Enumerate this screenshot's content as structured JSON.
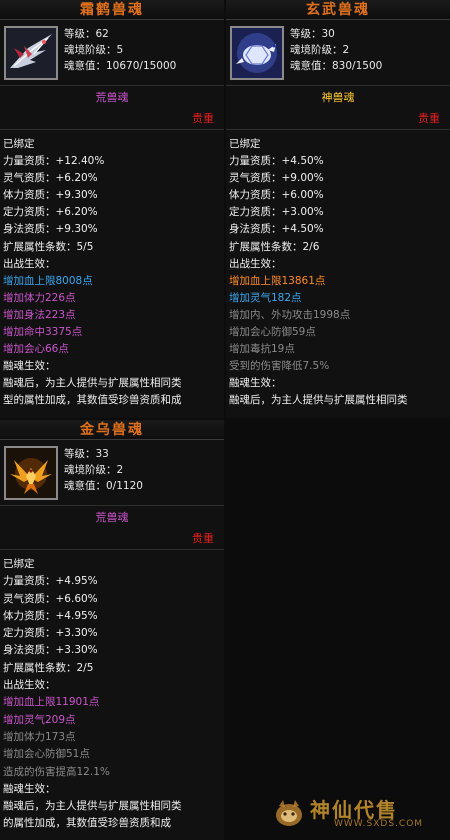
{
  "labels": {
    "level": "等级：",
    "realm": "魂境阶级：",
    "soul": "魂意值：",
    "valuable": "贵重",
    "bound": "已绑定",
    "ext_count": "扩展属性条数：",
    "battle": "出战生效：",
    "fusion": "融魂生效："
  },
  "cards": [
    {
      "title": "霜鹤兽魂",
      "icon": "frost-crane-icon",
      "level": "62",
      "realm": "5",
      "soul": "10670/15000",
      "grade": "荒兽魂",
      "aptitudes": [
        {
          "name": "力量资质：",
          "value": "+12.40%"
        },
        {
          "name": "灵气资质：",
          "value": "+6.20%"
        },
        {
          "name": "体力资质：",
          "value": "+9.30%"
        },
        {
          "name": "定力资质：",
          "value": "+6.20%"
        },
        {
          "name": "身法资质：",
          "value": "+9.30%"
        }
      ],
      "ext_count": "5/5",
      "effects": [
        {
          "text": "增加血上限8008点",
          "color": "blue"
        },
        {
          "text": "增加体力226点",
          "color": "purple"
        },
        {
          "text": "增加身法223点",
          "color": "purple"
        },
        {
          "text": "增加命中3375点",
          "color": "purple"
        },
        {
          "text": "增加会心66点",
          "color": "purple"
        }
      ],
      "fusion_text": [
        "融魂后，为主人提供与扩展属性相同类",
        "型的属性加成，其数值受珍兽资质和成"
      ]
    },
    {
      "title": "玄武兽魂",
      "icon": "black-tortoise-icon",
      "level": "30",
      "realm": "2",
      "soul": "830/1500",
      "grade": "神兽魂",
      "aptitudes": [
        {
          "name": "力量资质：",
          "value": "+4.50%"
        },
        {
          "name": "灵气资质：",
          "value": "+9.00%"
        },
        {
          "name": "体力资质：",
          "value": "+6.00%"
        },
        {
          "name": "定力资质：",
          "value": "+3.00%"
        },
        {
          "name": "身法资质：",
          "value": "+4.50%"
        }
      ],
      "ext_count": "2/6",
      "effects": [
        {
          "text": "增加血上限13861点",
          "color": "orange"
        },
        {
          "text": "增加灵气182点",
          "color": "blue"
        },
        {
          "text": "增加内、外功攻击1998点",
          "color": "gray"
        },
        {
          "text": "增加会心防御59点",
          "color": "gray"
        },
        {
          "text": "增加毒抗19点",
          "color": "gray"
        },
        {
          "text": "受到的伤害降低7.5%",
          "color": "gray"
        }
      ],
      "fusion_text": [
        "融魂后，为主人提供与扩展属性相同类"
      ]
    },
    {
      "title": "金乌兽魂",
      "icon": "golden-crow-icon",
      "level": "33",
      "realm": "2",
      "soul": "0/1120",
      "grade": "荒兽魂",
      "aptitudes": [
        {
          "name": "力量资质：",
          "value": "+4.95%"
        },
        {
          "name": "灵气资质：",
          "value": "+6.60%"
        },
        {
          "name": "体力资质：",
          "value": "+4.95%"
        },
        {
          "name": "定力资质：",
          "value": "+3.30%"
        },
        {
          "name": "身法资质：",
          "value": "+3.30%"
        }
      ],
      "ext_count": "2/5",
      "effects": [
        {
          "text": "增加血上限11901点",
          "color": "purple"
        },
        {
          "text": "增加灵气209点",
          "color": "purple"
        },
        {
          "text": "增加体力173点",
          "color": "gray"
        },
        {
          "text": "增加会心防御51点",
          "color": "gray"
        },
        {
          "text": "造成的伤害提高12.1%",
          "color": "gray"
        }
      ],
      "fusion_text": [
        "融魂后，为主人提供与扩展属性相同类",
        "的属性加成，其数值受珍兽资质和成"
      ]
    }
  ],
  "watermark": {
    "text": "神仙代售",
    "url": "WWW.SXDS.COM"
  }
}
